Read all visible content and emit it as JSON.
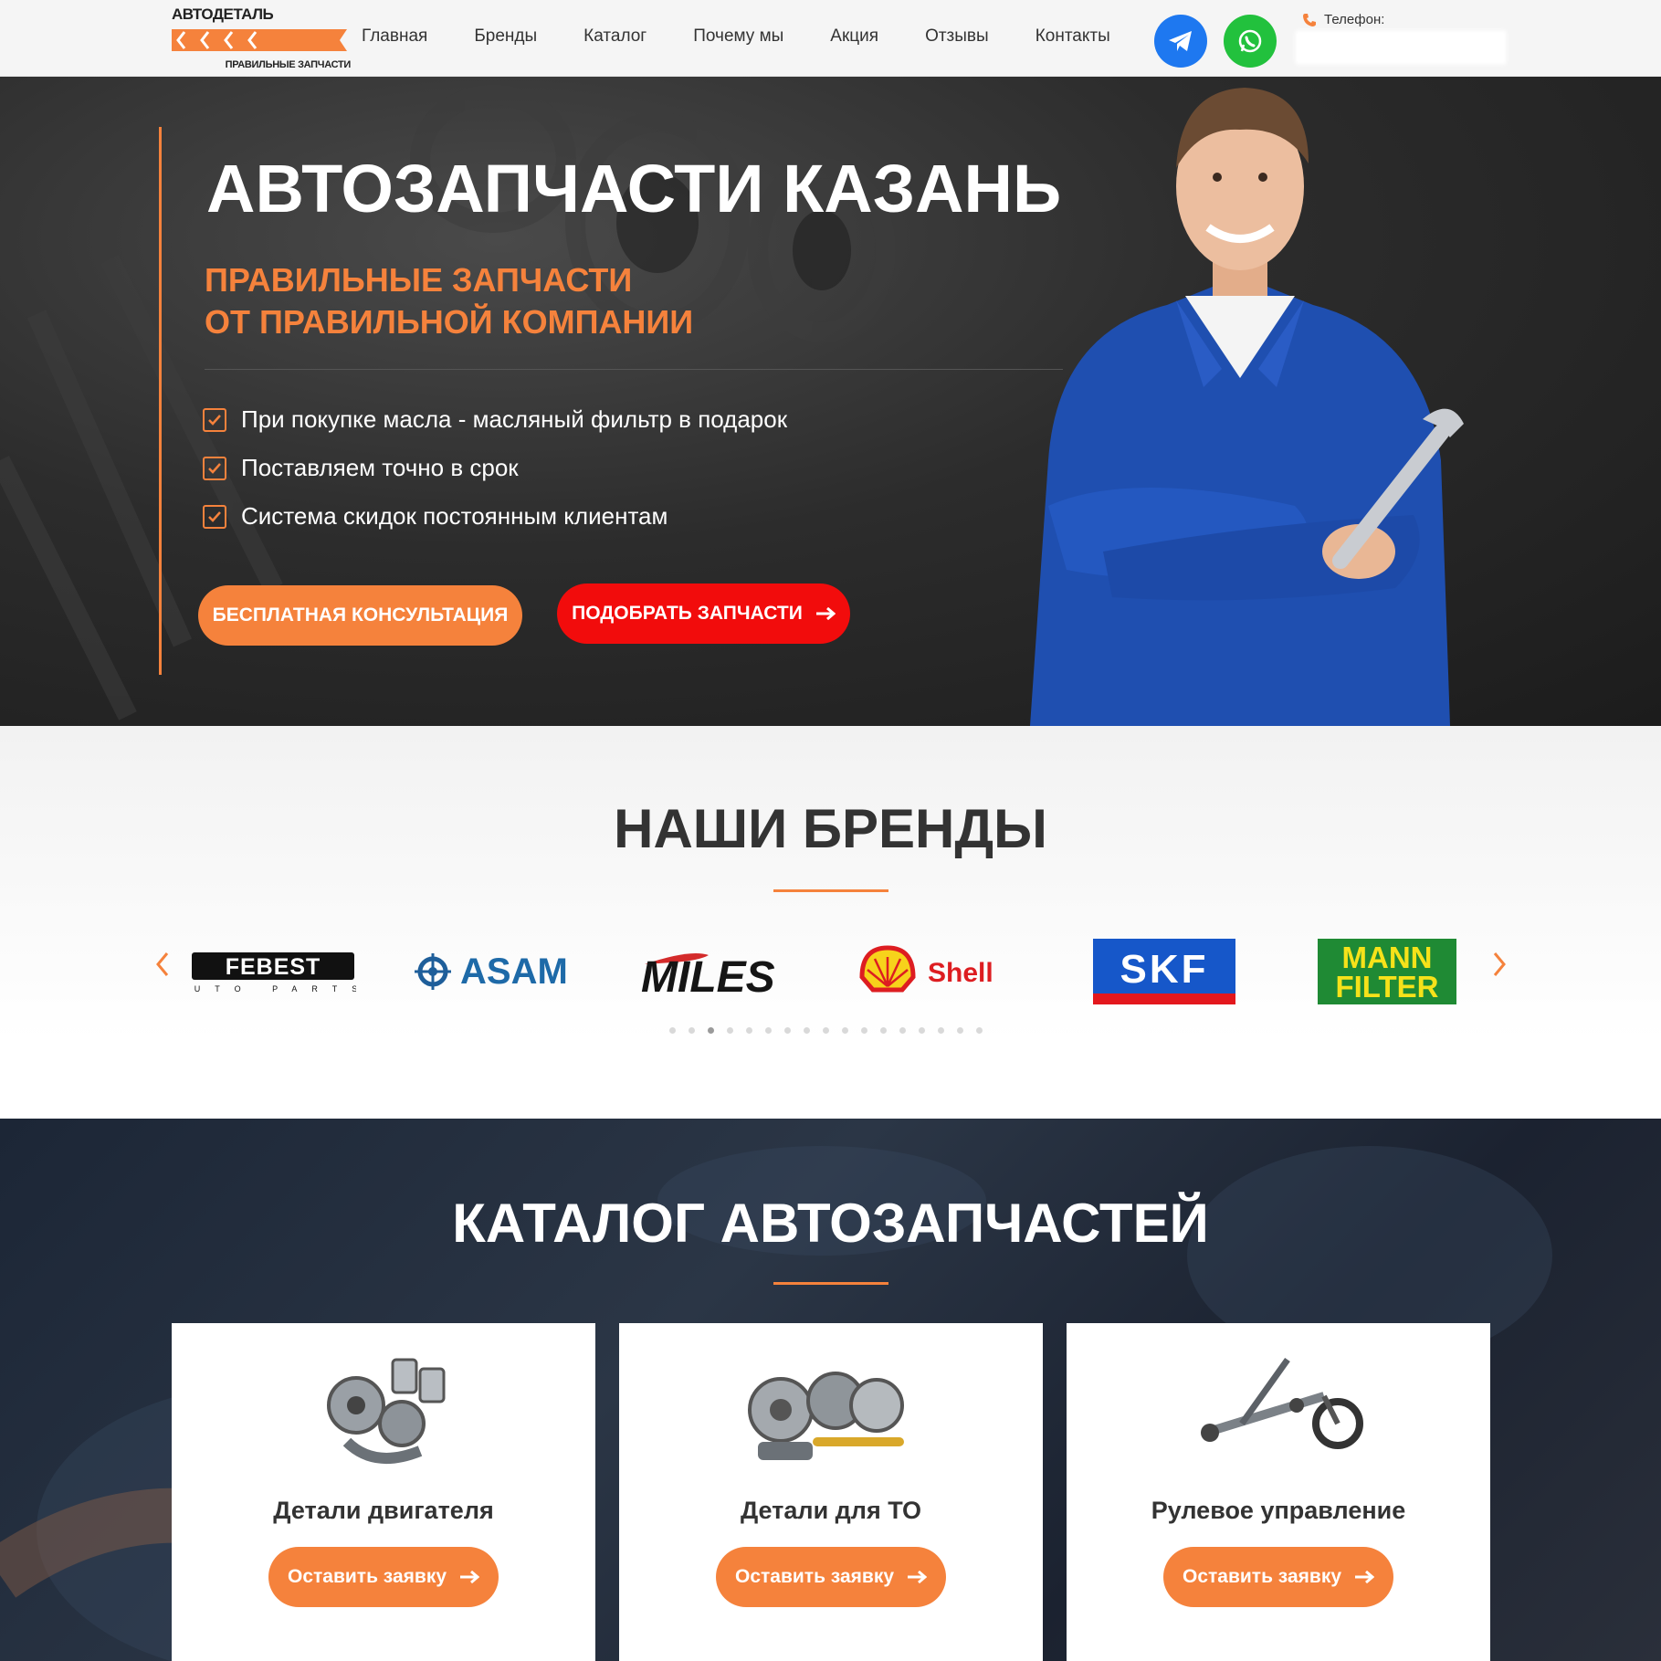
{
  "header": {
    "logo_name": "АВТОДЕТАЛЬ",
    "logo_tagline": "ПРАВИЛЬНЫЕ ЗАПЧАСТИ",
    "nav": [
      "Главная",
      "Бренды",
      "Каталог",
      "Почему мы",
      "Акция",
      "Отзывы",
      "Контакты"
    ],
    "phone_label": "Телефон:",
    "social": [
      "telegram-icon",
      "whatsapp-icon"
    ]
  },
  "hero": {
    "title": "АВТОЗАПЧАСТИ КАЗАНЬ",
    "subtitle_line1": "ПРАВИЛЬНЫЕ ЗАПЧАСТИ",
    "subtitle_line2": "ОТ ПРАВИЛЬНОЙ КОМПАНИИ",
    "features": [
      "При покупке масла - масляный фильтр в подарок",
      "Поставляем точно в срок",
      "Система скидок постоянным клиентам"
    ],
    "btn_consult": "БЕСПЛАТНАЯ КОНСУЛЬТАЦИЯ",
    "btn_pick": "ПОДОБРАТЬ ЗАПЧАСТИ"
  },
  "brands": {
    "title": "НАШИ БРЕНДЫ",
    "logos": [
      "FEBEST",
      "AUTO PARTS",
      "ASAM",
      "MILES",
      "Shell",
      "SKF",
      "MANN",
      "FILTER"
    ],
    "dots_total": 17,
    "dots_active": 3
  },
  "catalog": {
    "title": "КАТАЛОГ АВТОЗАПЧАСТЕЙ",
    "cards": [
      {
        "title": "Детали двигателя",
        "button": "Оставить заявку"
      },
      {
        "title": "Детали для ТО",
        "button": "Оставить заявку"
      },
      {
        "title": "Рулевое управление",
        "button": "Оставить заявку"
      }
    ]
  },
  "colors": {
    "accent": "#f5823c",
    "red": "#f20c0c",
    "telegram": "#1e78f0",
    "whatsapp": "#22c13d"
  }
}
